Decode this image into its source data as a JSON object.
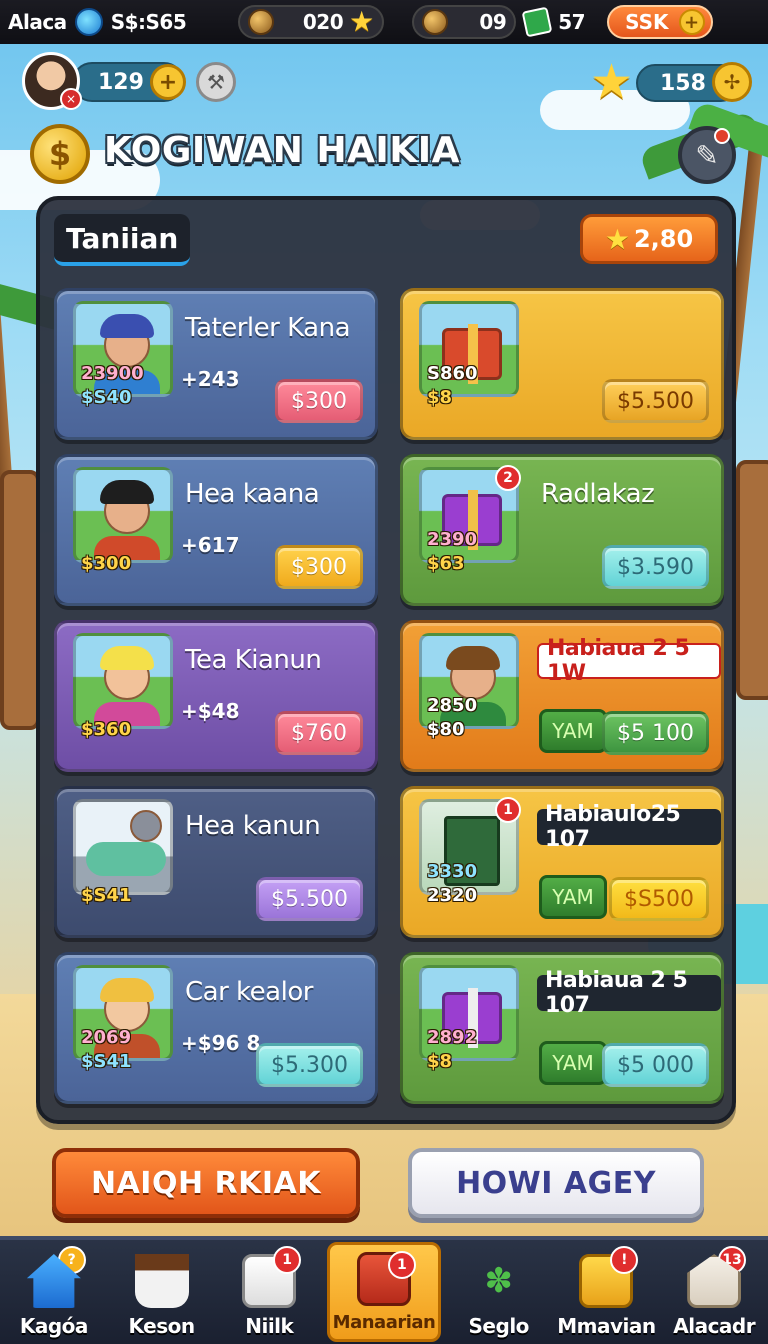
{
  "topbar": {
    "app_name": "Alaca",
    "currency_label": "S$:S65",
    "coins_value": "020",
    "gems_value": "09",
    "energy_value": "57",
    "shop_label": "SSK"
  },
  "profile": {
    "level_value": "129",
    "stars_value": "158"
  },
  "header": {
    "title": "KOGIWAN HAIKIA",
    "coin_symbol": "$"
  },
  "panel": {
    "tab_label": "Taniian",
    "star_total": "2,80"
  },
  "cards": [
    {
      "title": "Taterler Kana",
      "stat1": "23900",
      "stat2": "$S40",
      "sub": "+243",
      "price": "$300"
    },
    {
      "title": "",
      "stat1": "S860",
      "stat2": "$8",
      "price": "$5.500"
    },
    {
      "title": "Hea kaana",
      "stat1": "$300",
      "stat2": "",
      "sub": "+617",
      "price": "$300"
    },
    {
      "title": "Radlakaz",
      "stat1": "2390",
      "stat2": "$63",
      "price": "$3.590",
      "badge": "2"
    },
    {
      "title": "Tea Kianun",
      "stat1": "$360",
      "stat2": "",
      "sub": "+$48",
      "price": "$760"
    },
    {
      "tag": "Habiaua 2 5 1W",
      "stat1": "2850",
      "stat2": "$80",
      "yam": "YAM",
      "price": "$5 100"
    },
    {
      "title": "Hea kanun",
      "stat1": "$S41",
      "stat2": "",
      "price": "$5.500"
    },
    {
      "tag": "Habiaulo25 107",
      "stat1": "3330",
      "stat2": "2320",
      "yam": "YAM",
      "price": "$S500",
      "badge": "1"
    },
    {
      "title": "Car kealor",
      "stat1": "2069",
      "stat2": "$S41",
      "sub": "+$96 8",
      "price": "$5.300"
    },
    {
      "tag": "Habiaua 2 5 107",
      "stat1": "2892",
      "stat2": "$8",
      "yam": "YAM",
      "price": "$5 000"
    }
  ],
  "actions": {
    "primary": "NAIQH RKIAK",
    "secondary": "HOWI AGEY"
  },
  "nav": [
    {
      "label": "Kagóa",
      "icon": "house-icon",
      "badge": "?"
    },
    {
      "label": "Keson",
      "icon": "pot-icon",
      "badge": ""
    },
    {
      "label": "Niilk",
      "icon": "bag-icon",
      "badge": "1"
    },
    {
      "label": "Manaarian",
      "icon": "chest-icon",
      "badge": "1",
      "active": true
    },
    {
      "label": "Seglo",
      "icon": "plant-icon",
      "badge": ""
    },
    {
      "label": "Mmavian",
      "icon": "gift-icon",
      "badge": "!"
    },
    {
      "label": "Alacadr",
      "icon": "barn-icon",
      "badge": "13"
    }
  ],
  "colors": {
    "accent": "#e2561a",
    "panel_bg": "#2c323e",
    "tab_underline": "#2aa1e8"
  }
}
